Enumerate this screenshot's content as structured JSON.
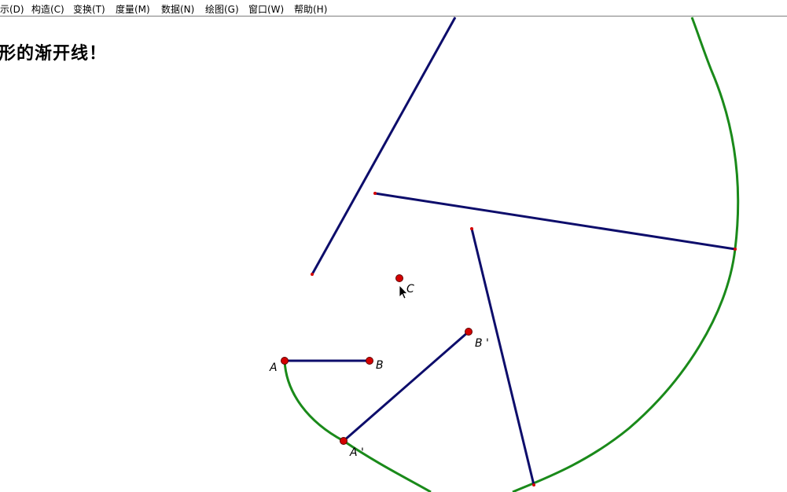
{
  "menu": {
    "items": [
      {
        "label": "示(D)"
      },
      {
        "label": "构造(C)"
      },
      {
        "label": "变换(T)"
      },
      {
        "label": "度量(M)"
      },
      {
        "label": "数据(N)"
      },
      {
        "label": "绘图(G)"
      },
      {
        "label": "窗口(W)"
      },
      {
        "label": "帮助(H)"
      }
    ]
  },
  "document": {
    "title": "形的渐开线！"
  },
  "sketch": {
    "colors": {
      "segment": "#0d0d6b",
      "curve": "#1a8a1a",
      "point": "#d40000",
      "point_outline": "#600000"
    },
    "points": {
      "A": "A",
      "B": "B",
      "C": "C",
      "A_prime": "A '",
      "B_prime": "B '"
    }
  }
}
